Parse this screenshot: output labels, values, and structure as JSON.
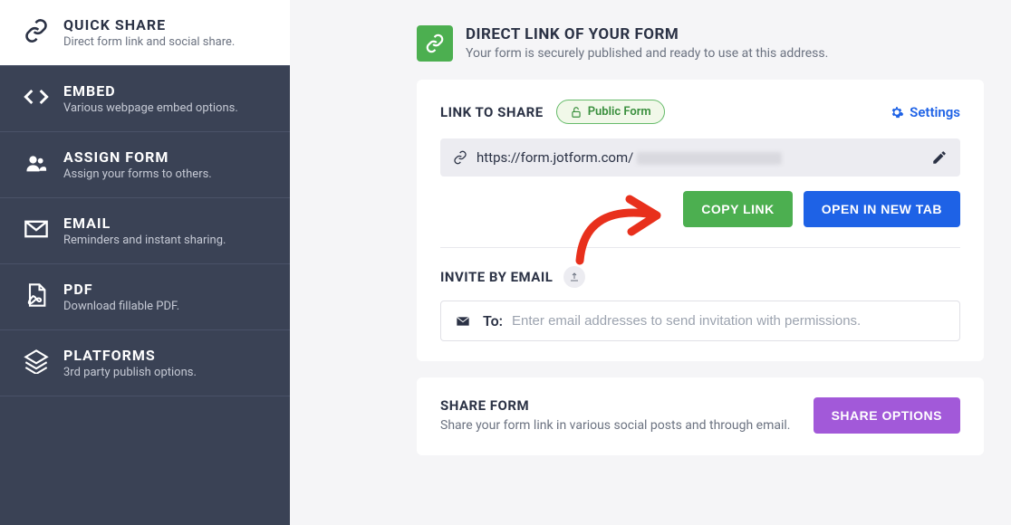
{
  "sidebar": {
    "items": [
      {
        "title": "QUICK SHARE",
        "desc": "Direct form link and social share."
      },
      {
        "title": "EMBED",
        "desc": "Various webpage embed options."
      },
      {
        "title": "ASSIGN FORM",
        "desc": "Assign your forms to others."
      },
      {
        "title": "EMAIL",
        "desc": "Reminders and instant sharing."
      },
      {
        "title": "PDF",
        "desc": "Download fillable PDF."
      },
      {
        "title": "PLATFORMS",
        "desc": "3rd party publish options."
      }
    ]
  },
  "header": {
    "title": "DIRECT LINK OF YOUR FORM",
    "sub": "Your form is securely published and ready to use at this address."
  },
  "linkCard": {
    "title": "LINK TO SHARE",
    "badge": "Public Form",
    "settings": "Settings",
    "url": "https://form.jotform.com/",
    "copy": "COPY LINK",
    "open": "OPEN IN NEW TAB"
  },
  "invite": {
    "title": "INVITE BY EMAIL",
    "to": "To:",
    "placeholder": "Enter email addresses to send invitation with permissions."
  },
  "shareCard": {
    "title": "SHARE FORM",
    "desc": "Share your form link in various social posts and through email.",
    "button": "SHARE OPTIONS"
  }
}
